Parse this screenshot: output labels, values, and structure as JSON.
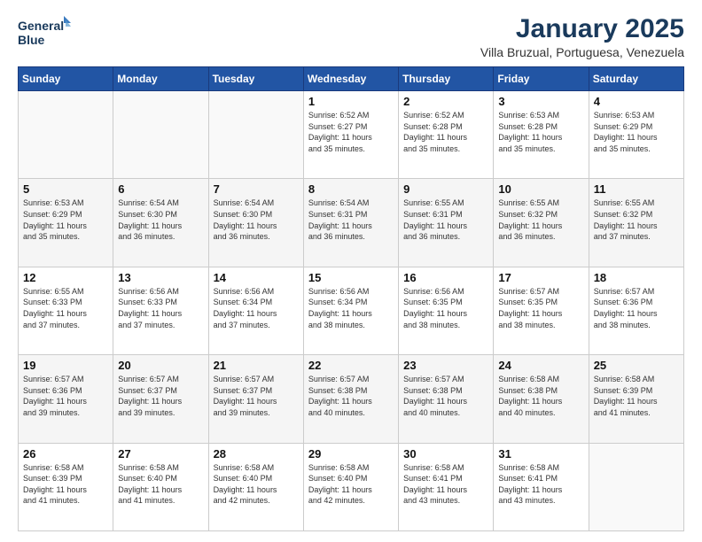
{
  "logo": {
    "line1": "General",
    "line2": "Blue"
  },
  "title": "January 2025",
  "subtitle": "Villa Bruzual, Portuguesa, Venezuela",
  "weekdays": [
    "Sunday",
    "Monday",
    "Tuesday",
    "Wednesday",
    "Thursday",
    "Friday",
    "Saturday"
  ],
  "weeks": [
    [
      {
        "day": "",
        "info": ""
      },
      {
        "day": "",
        "info": ""
      },
      {
        "day": "",
        "info": ""
      },
      {
        "day": "1",
        "info": "Sunrise: 6:52 AM\nSunset: 6:27 PM\nDaylight: 11 hours\nand 35 minutes."
      },
      {
        "day": "2",
        "info": "Sunrise: 6:52 AM\nSunset: 6:28 PM\nDaylight: 11 hours\nand 35 minutes."
      },
      {
        "day": "3",
        "info": "Sunrise: 6:53 AM\nSunset: 6:28 PM\nDaylight: 11 hours\nand 35 minutes."
      },
      {
        "day": "4",
        "info": "Sunrise: 6:53 AM\nSunset: 6:29 PM\nDaylight: 11 hours\nand 35 minutes."
      }
    ],
    [
      {
        "day": "5",
        "info": "Sunrise: 6:53 AM\nSunset: 6:29 PM\nDaylight: 11 hours\nand 35 minutes."
      },
      {
        "day": "6",
        "info": "Sunrise: 6:54 AM\nSunset: 6:30 PM\nDaylight: 11 hours\nand 36 minutes."
      },
      {
        "day": "7",
        "info": "Sunrise: 6:54 AM\nSunset: 6:30 PM\nDaylight: 11 hours\nand 36 minutes."
      },
      {
        "day": "8",
        "info": "Sunrise: 6:54 AM\nSunset: 6:31 PM\nDaylight: 11 hours\nand 36 minutes."
      },
      {
        "day": "9",
        "info": "Sunrise: 6:55 AM\nSunset: 6:31 PM\nDaylight: 11 hours\nand 36 minutes."
      },
      {
        "day": "10",
        "info": "Sunrise: 6:55 AM\nSunset: 6:32 PM\nDaylight: 11 hours\nand 36 minutes."
      },
      {
        "day": "11",
        "info": "Sunrise: 6:55 AM\nSunset: 6:32 PM\nDaylight: 11 hours\nand 37 minutes."
      }
    ],
    [
      {
        "day": "12",
        "info": "Sunrise: 6:55 AM\nSunset: 6:33 PM\nDaylight: 11 hours\nand 37 minutes."
      },
      {
        "day": "13",
        "info": "Sunrise: 6:56 AM\nSunset: 6:33 PM\nDaylight: 11 hours\nand 37 minutes."
      },
      {
        "day": "14",
        "info": "Sunrise: 6:56 AM\nSunset: 6:34 PM\nDaylight: 11 hours\nand 37 minutes."
      },
      {
        "day": "15",
        "info": "Sunrise: 6:56 AM\nSunset: 6:34 PM\nDaylight: 11 hours\nand 38 minutes."
      },
      {
        "day": "16",
        "info": "Sunrise: 6:56 AM\nSunset: 6:35 PM\nDaylight: 11 hours\nand 38 minutes."
      },
      {
        "day": "17",
        "info": "Sunrise: 6:57 AM\nSunset: 6:35 PM\nDaylight: 11 hours\nand 38 minutes."
      },
      {
        "day": "18",
        "info": "Sunrise: 6:57 AM\nSunset: 6:36 PM\nDaylight: 11 hours\nand 38 minutes."
      }
    ],
    [
      {
        "day": "19",
        "info": "Sunrise: 6:57 AM\nSunset: 6:36 PM\nDaylight: 11 hours\nand 39 minutes."
      },
      {
        "day": "20",
        "info": "Sunrise: 6:57 AM\nSunset: 6:37 PM\nDaylight: 11 hours\nand 39 minutes."
      },
      {
        "day": "21",
        "info": "Sunrise: 6:57 AM\nSunset: 6:37 PM\nDaylight: 11 hours\nand 39 minutes."
      },
      {
        "day": "22",
        "info": "Sunrise: 6:57 AM\nSunset: 6:38 PM\nDaylight: 11 hours\nand 40 minutes."
      },
      {
        "day": "23",
        "info": "Sunrise: 6:57 AM\nSunset: 6:38 PM\nDaylight: 11 hours\nand 40 minutes."
      },
      {
        "day": "24",
        "info": "Sunrise: 6:58 AM\nSunset: 6:38 PM\nDaylight: 11 hours\nand 40 minutes."
      },
      {
        "day": "25",
        "info": "Sunrise: 6:58 AM\nSunset: 6:39 PM\nDaylight: 11 hours\nand 41 minutes."
      }
    ],
    [
      {
        "day": "26",
        "info": "Sunrise: 6:58 AM\nSunset: 6:39 PM\nDaylight: 11 hours\nand 41 minutes."
      },
      {
        "day": "27",
        "info": "Sunrise: 6:58 AM\nSunset: 6:40 PM\nDaylight: 11 hours\nand 41 minutes."
      },
      {
        "day": "28",
        "info": "Sunrise: 6:58 AM\nSunset: 6:40 PM\nDaylight: 11 hours\nand 42 minutes."
      },
      {
        "day": "29",
        "info": "Sunrise: 6:58 AM\nSunset: 6:40 PM\nDaylight: 11 hours\nand 42 minutes."
      },
      {
        "day": "30",
        "info": "Sunrise: 6:58 AM\nSunset: 6:41 PM\nDaylight: 11 hours\nand 43 minutes."
      },
      {
        "day": "31",
        "info": "Sunrise: 6:58 AM\nSunset: 6:41 PM\nDaylight: 11 hours\nand 43 minutes."
      },
      {
        "day": "",
        "info": ""
      }
    ]
  ],
  "colors": {
    "header_bg": "#2255a4",
    "header_text": "#ffffff",
    "title_color": "#1a3a5c",
    "border": "#cccccc"
  }
}
